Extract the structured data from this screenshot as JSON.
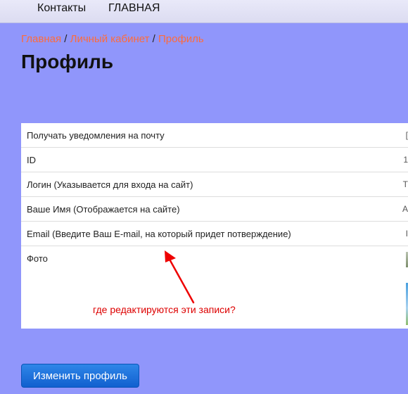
{
  "nav": {
    "contacts": "Контакты",
    "home": "ГЛАВНАЯ"
  },
  "breadcrumb": {
    "items": [
      "Главная",
      "Личный кабинет",
      "Профиль"
    ],
    "separator": "/"
  },
  "page_title": "Профиль",
  "profile_table": {
    "rows": [
      {
        "label": "Получать уведомления на почту",
        "edge": "["
      },
      {
        "label": "ID",
        "edge": "1"
      },
      {
        "label": "Логин (Указывается для входа на сайт)",
        "edge": "T"
      },
      {
        "label": "Ваше Имя (Отображается на сайте)",
        "edge": "А"
      },
      {
        "label": "Email (Введите Ваш E-mail, на который придет потверждение)",
        "edge": "I"
      },
      {
        "label": "Фото"
      }
    ]
  },
  "annotation": {
    "text": "где редактируются эти записи?",
    "color": "#dd0000"
  },
  "edit_button_label": "Изменить профиль",
  "colors": {
    "page_background": "#9096fb",
    "breadcrumb_link": "#ff6b3b",
    "button": "#1f72dd"
  }
}
